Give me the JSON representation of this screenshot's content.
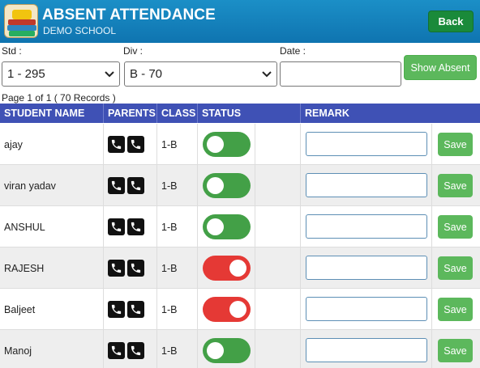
{
  "header": {
    "title": "ABSENT ATTENDANCE",
    "school": "DEMO SCHOOL",
    "back_label": "Back"
  },
  "filters": {
    "std_label": "Std :",
    "std_value": "1 - 295",
    "div_label": "Div :",
    "div_value": "B - 70",
    "date_label": "Date :",
    "date_value": "",
    "show_label": "Show Absent"
  },
  "records_text": "Page 1 of 1 ( 70 Records )",
  "columns": [
    "STUDENT NAME",
    "PARENTS",
    "CLASS",
    "STATUS",
    "REMARK"
  ],
  "rows": [
    {
      "name": "ajay",
      "class": "1-B",
      "status": "present",
      "save": "Save"
    },
    {
      "name": "viran yadav",
      "class": "1-B",
      "status": "present",
      "save": "Save"
    },
    {
      "name": "ANSHUL",
      "class": "1-B",
      "status": "present",
      "save": "Save"
    },
    {
      "name": "RAJESH",
      "class": "1-B",
      "status": "absent",
      "save": "Save"
    },
    {
      "name": "Baljeet",
      "class": "1-B",
      "status": "absent",
      "save": "Save"
    },
    {
      "name": "Manoj",
      "class": "1-B",
      "status": "present",
      "save": "Save"
    }
  ],
  "colors": {
    "header": "#1b8fc7",
    "table_header": "#3f51b5",
    "toggle_on": "#43a047",
    "toggle_off": "#e53935",
    "button_green": "#5cb85c"
  },
  "icons": {
    "parent_call": "phone-icon",
    "select_arrow": "chevron-down-icon"
  }
}
